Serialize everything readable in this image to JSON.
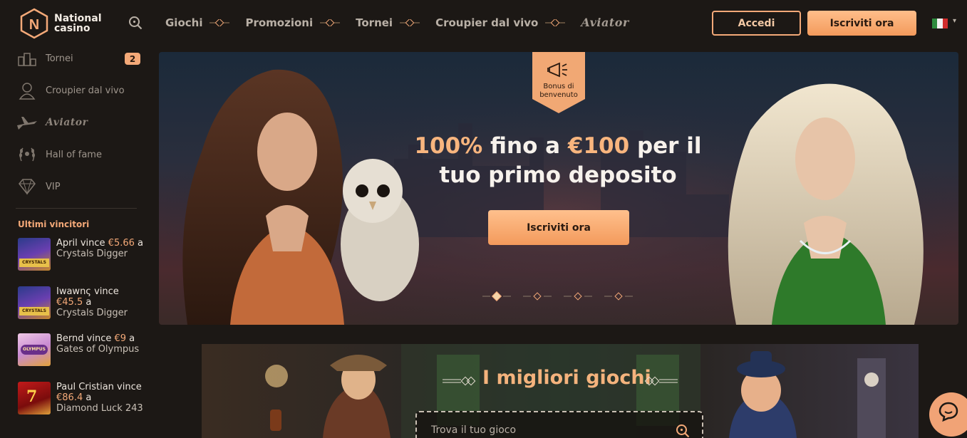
{
  "brand": {
    "name_line1": "National",
    "name_line2": "casino",
    "logo_letter": "N"
  },
  "nav": {
    "items": [
      "Giochi",
      "Promozioni",
      "Tornei",
      "Croupier dal vivo"
    ],
    "aviator": "Aviator"
  },
  "header": {
    "login_label": "Accedi",
    "signup_label": "Iscriviti ora"
  },
  "sidebar": {
    "items": [
      {
        "label": "Tornei",
        "icon": "tournament-icon",
        "badge": "2"
      },
      {
        "label": "Croupier dal vivo",
        "icon": "dealer-icon"
      },
      {
        "label": "Aviator",
        "icon": "aviator-plane-icon"
      },
      {
        "label": "Hall of fame",
        "icon": "laurel-icon"
      },
      {
        "label": "VIP",
        "icon": "diamond-icon"
      }
    ],
    "winners_title": "Ultimi vincitori",
    "winners": [
      {
        "name": "April vince ",
        "amount": "€5.66",
        "mid": " a",
        "game": "Crystals Digger"
      },
      {
        "name": "Iwawnς vince",
        "amount": "€45.5",
        "mid": " a",
        "game": "Crystals Digger"
      },
      {
        "name": "Bernd vince ",
        "amount": "€9",
        "mid": " a",
        "game": "Gates of Olympus"
      },
      {
        "name": "Paul Cristian vince ",
        "amount": "€86.4",
        "mid": " a",
        "game": "Diamond Luck 243"
      }
    ]
  },
  "hero": {
    "bonus_tag_line1": "Bonus di",
    "bonus_tag_line2": "benvenuto",
    "title_pct": "100%",
    "title_mid": " fino a ",
    "title_amount": "€100",
    "title_rest": " per il tuo primo deposito",
    "cta": "Iscriviti ora",
    "slides_total": 4,
    "slide_active": 1
  },
  "games": {
    "title": "I migliori giochi",
    "search_placeholder": "Trova il tuo gioco"
  },
  "colors": {
    "accent": "#f4a978",
    "bg": "#1c1815",
    "cta_top": "#ffc08d",
    "cta_bottom": "#f39a5c"
  }
}
